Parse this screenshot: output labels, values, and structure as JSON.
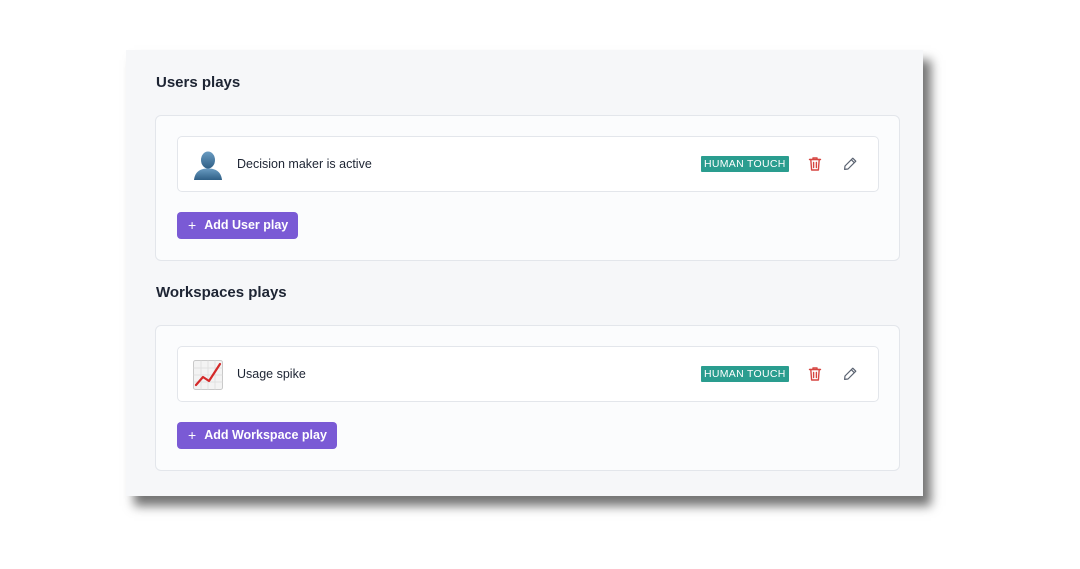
{
  "users_section": {
    "title": "Users plays",
    "plays": [
      {
        "icon": "person-silhouette-icon",
        "label": "Decision maker is active",
        "badge": "HUMAN TOUCH"
      }
    ],
    "add_label": "Add User play"
  },
  "workspaces_section": {
    "title": "Workspaces plays",
    "plays": [
      {
        "icon": "chart-increasing-icon",
        "label": "Usage spike",
        "badge": "HUMAN TOUCH"
      }
    ],
    "add_label": "Add Workspace play"
  },
  "add_icon": "plus-icon",
  "delete_icon": "trash-icon",
  "edit_icon": "pencil-icon",
  "colors": {
    "badge": "#2a9d8f",
    "add_button": "#7a5ad5",
    "delete_icon": "#d64541",
    "edit_icon": "#5a6270"
  }
}
